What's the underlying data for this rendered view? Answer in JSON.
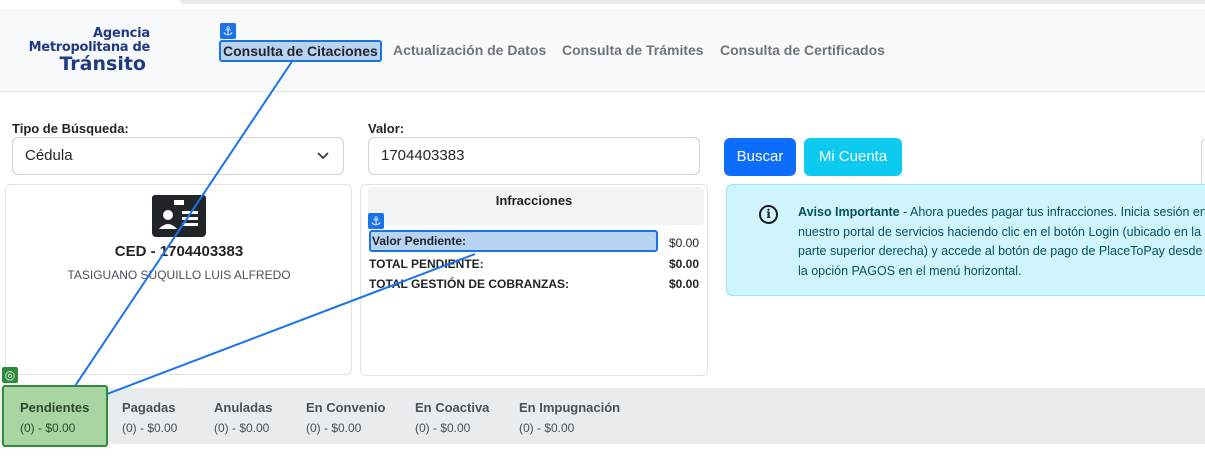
{
  "logo": {
    "line1": "Agencia",
    "line2": "Metropolitana de",
    "line3": "Tránsito"
  },
  "nav": {
    "items": [
      {
        "label": "Consulta de Citaciones"
      },
      {
        "label": "Actualización de Datos"
      },
      {
        "label": "Consulta de Trámites"
      },
      {
        "label": "Consulta de Certificados"
      }
    ]
  },
  "search": {
    "type_label": "Tipo de Búsqueda:",
    "type_value": "Cédula",
    "value_label": "Valor:",
    "value": "1704403383",
    "search_button": "Buscar",
    "account_button": "Mi Cuenta"
  },
  "person": {
    "ced": "CED - 1704403383",
    "name": "TASIGUANO SUQUILLO LUIS ALFREDO"
  },
  "infracciones": {
    "title": "Infracciones",
    "rows": [
      {
        "label": "Valor Pendiente:",
        "value": "$0.00"
      },
      {
        "label": "TOTAL PENDIENTE:",
        "value": "$0.00"
      },
      {
        "label": "TOTAL GESTIÓN DE COBRANZAS:",
        "value": "$0.00"
      }
    ]
  },
  "notice": {
    "title": "Aviso Importante",
    "text": " - Ahora puedes pagar tus infracciones. Inicia sesión en nuestro portal de servicios haciendo clic en el botón Login (ubicado en la parte superior derecha) y accede al botón de pago de PlaceToPay desde la opción PAGOS en el menú horizontal."
  },
  "tabs": [
    {
      "label": "Pendientes",
      "summary": "(0) - $0.00"
    },
    {
      "label": "Pagadas",
      "summary": "(0) - $0.00"
    },
    {
      "label": "Anuladas",
      "summary": "(0) - $0.00"
    },
    {
      "label": "En Convenio",
      "summary": "(0) - $0.00"
    },
    {
      "label": "En Coactiva",
      "summary": "(0) - $0.00"
    },
    {
      "label": "En Impugnación",
      "summary": "(0) - $0.00"
    }
  ],
  "colors": {
    "primary": "#0d6efd",
    "info": "#0dcaf0",
    "brand": "#1f3b86",
    "highlight_blue": "#1a73e8",
    "highlight_green": "#2e8b3a"
  }
}
